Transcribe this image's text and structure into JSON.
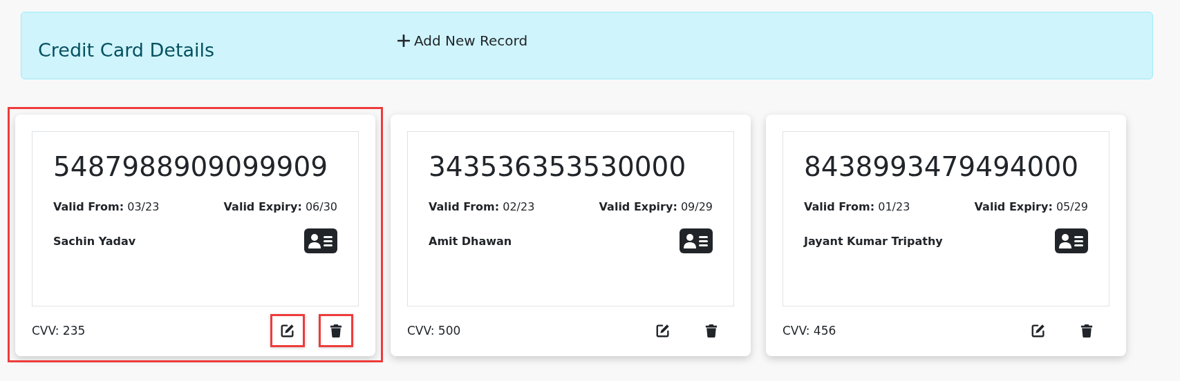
{
  "header": {
    "title": "Credit Card Details",
    "add_button": "Add New Record"
  },
  "cards": [
    {
      "number": "5487988909099909",
      "from_label": "Valid From:",
      "from": "03/23",
      "expiry_label": "Valid Expiry:",
      "expiry": "06/30",
      "holder": "Sachin Yadav",
      "cvv": "CVV: 235",
      "highlighted": true,
      "edit_highlighted": true,
      "delete_highlighted": true
    },
    {
      "number": "343536353530000",
      "from_label": "Valid From:",
      "from": "02/23",
      "expiry_label": "Valid Expiry:",
      "expiry": "09/29",
      "holder": "Amit Dhawan",
      "cvv": "CVV: 500",
      "highlighted": false,
      "edit_highlighted": false,
      "delete_highlighted": false
    },
    {
      "number": "8438993479494000",
      "from_label": "Valid From:",
      "from": "01/23",
      "expiry_label": "Valid Expiry:",
      "expiry": "05/29",
      "holder": "Jayant Kumar Tripathy",
      "cvv": "CVV: 456",
      "highlighted": false,
      "edit_highlighted": false,
      "delete_highlighted": false
    }
  ]
}
